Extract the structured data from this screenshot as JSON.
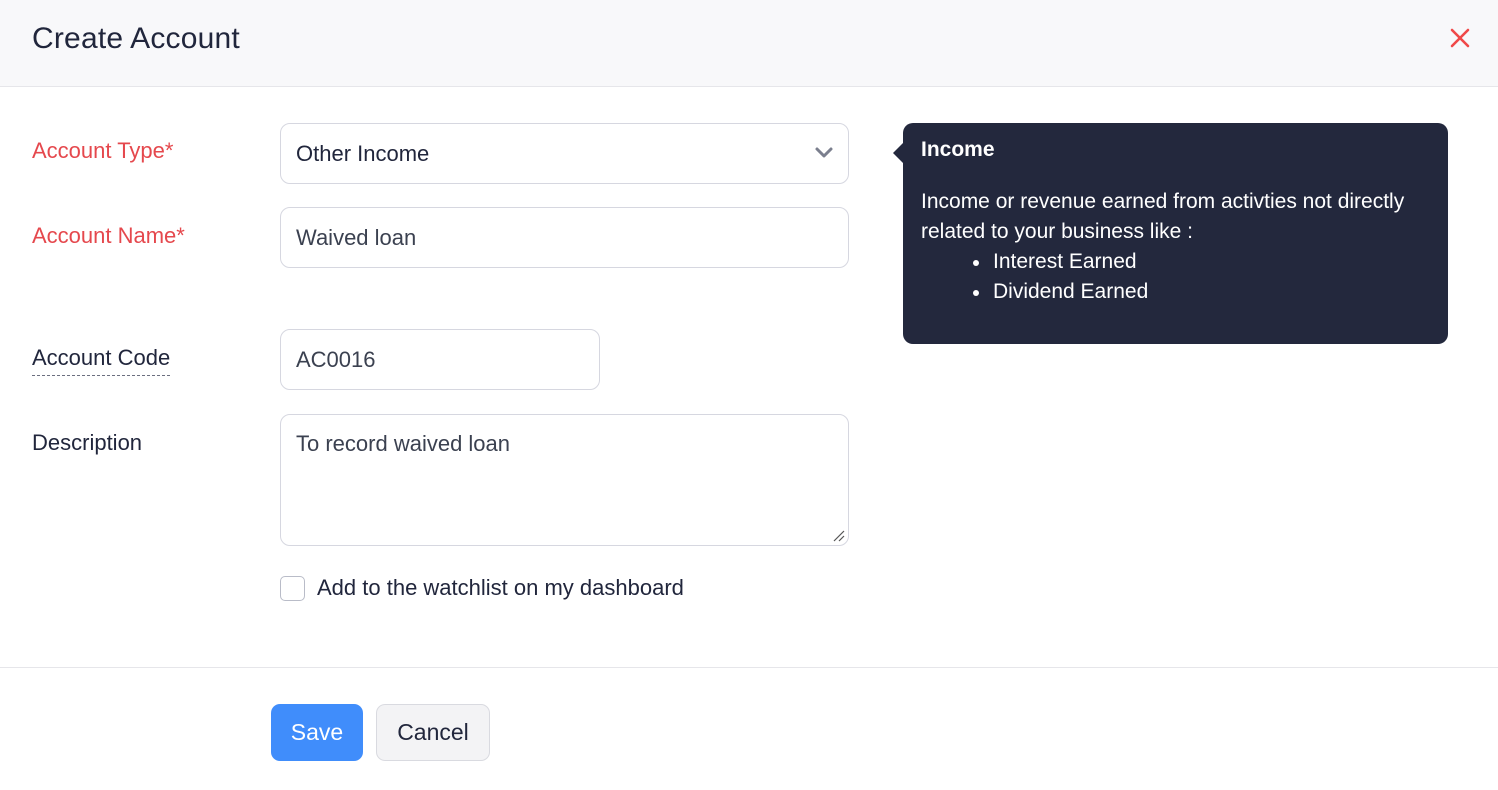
{
  "header": {
    "title": "Create Account",
    "close_icon": "close-icon",
    "close_color": "#f04848"
  },
  "form": {
    "account_type": {
      "label": "Account Type*",
      "selected": "Other Income",
      "required": true
    },
    "account_name": {
      "label": "Account Name*",
      "value": "Waived loan",
      "required": true
    },
    "account_code": {
      "label": "Account Code",
      "value": "AC0016"
    },
    "description": {
      "label": "Description",
      "value": "To record waived loan"
    },
    "watchlist": {
      "label": "Add to the watchlist on my dashboard",
      "checked": false
    }
  },
  "tooltip": {
    "title": "Income",
    "body": "Income or revenue earned from activties not directly related to your business like :",
    "items": [
      "Interest Earned",
      "Dividend Earned"
    ]
  },
  "footer": {
    "save_label": "Save",
    "cancel_label": "Cancel"
  },
  "colors": {
    "primary": "#408dfb",
    "required_label": "#e5484d",
    "tooltip_bg": "#23283d"
  }
}
